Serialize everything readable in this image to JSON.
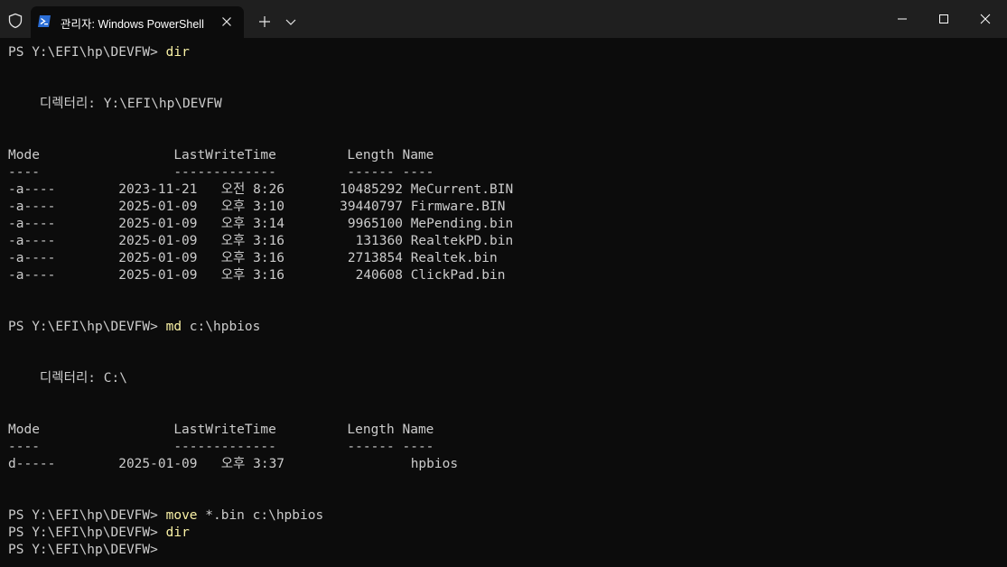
{
  "titlebar": {
    "tab_title": "관리자: Windows PowerShell"
  },
  "terminal": {
    "lines": [
      {
        "prompt": "PS Y:\\EFI\\hp\\DEVFW> ",
        "cmd": "dir",
        "args": ""
      },
      {
        "text": ""
      },
      {
        "text": ""
      },
      {
        "text": "    디렉터리: Y:\\EFI\\hp\\DEVFW"
      },
      {
        "text": ""
      },
      {
        "text": ""
      },
      {
        "text": "Mode                 LastWriteTime         Length Name"
      },
      {
        "text": "----                 -------------         ------ ----"
      },
      {
        "text": "-a----        2023-11-21   오전 8:26       10485292 MeCurrent.BIN"
      },
      {
        "text": "-a----        2025-01-09   오후 3:10       39440797 Firmware.BIN"
      },
      {
        "text": "-a----        2025-01-09   오후 3:14        9965100 MePending.bin"
      },
      {
        "text": "-a----        2025-01-09   오후 3:16         131360 RealtekPD.bin"
      },
      {
        "text": "-a----        2025-01-09   오후 3:16        2713854 Realtek.bin"
      },
      {
        "text": "-a----        2025-01-09   오후 3:16         240608 ClickPad.bin"
      },
      {
        "text": ""
      },
      {
        "text": ""
      },
      {
        "prompt": "PS Y:\\EFI\\hp\\DEVFW> ",
        "cmd": "md",
        "args": " c:\\hpbios"
      },
      {
        "text": ""
      },
      {
        "text": ""
      },
      {
        "text": "    디렉터리: C:\\"
      },
      {
        "text": ""
      },
      {
        "text": ""
      },
      {
        "text": "Mode                 LastWriteTime         Length Name"
      },
      {
        "text": "----                 -------------         ------ ----"
      },
      {
        "text": "d-----        2025-01-09   오후 3:37                hpbios"
      },
      {
        "text": ""
      },
      {
        "text": ""
      },
      {
        "prompt": "PS Y:\\EFI\\hp\\DEVFW> ",
        "cmd": "move",
        "args": " *.bin c:\\hpbios"
      },
      {
        "prompt": "PS Y:\\EFI\\hp\\DEVFW> ",
        "cmd": "dir",
        "args": ""
      },
      {
        "prompt": "PS Y:\\EFI\\hp\\DEVFW> ",
        "cmd": "",
        "args": ""
      }
    ]
  }
}
